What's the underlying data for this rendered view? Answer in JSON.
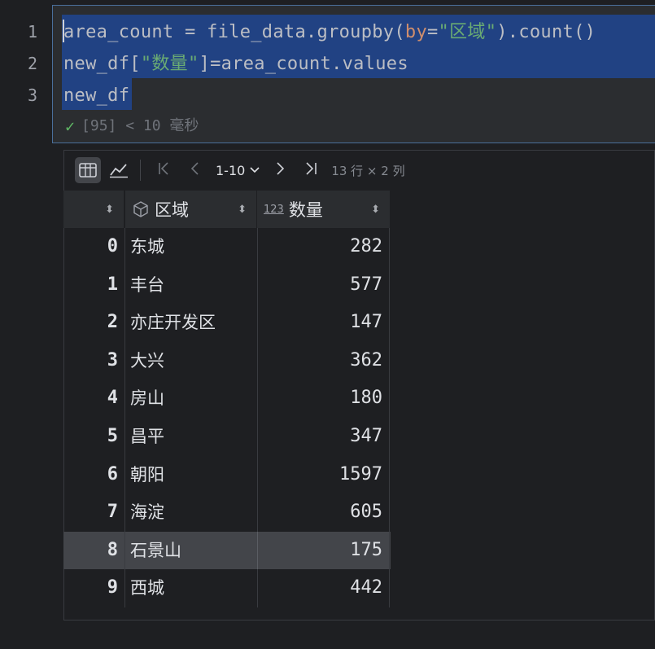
{
  "editor": {
    "line_numbers": [
      "1",
      "2",
      "3"
    ],
    "lines": [
      [
        {
          "t": "area_count = file_data.groupby(",
          "k": "plain"
        },
        {
          "t": "by",
          "k": "param"
        },
        {
          "t": "=",
          "k": "plain"
        },
        {
          "t": "\"区域\"",
          "k": "str"
        },
        {
          "t": ").count()",
          "k": "plain"
        }
      ],
      [
        {
          "t": "new_df[",
          "k": "plain"
        },
        {
          "t": "\"数量\"",
          "k": "str"
        },
        {
          "t": "]=area_count.values",
          "k": "plain"
        }
      ],
      [
        {
          "t": "new_df",
          "k": "plain"
        }
      ]
    ],
    "exec_status": "[95] < 10 毫秒"
  },
  "toolbar": {
    "page_range": "1-10",
    "row_col_info": "13 行 × 2 列"
  },
  "table": {
    "columns": [
      "区域",
      "数量"
    ],
    "rows": [
      {
        "idx": "0",
        "area": "东城",
        "count": "282"
      },
      {
        "idx": "1",
        "area": "丰台",
        "count": "577"
      },
      {
        "idx": "2",
        "area": "亦庄开发区",
        "count": "147"
      },
      {
        "idx": "3",
        "area": "大兴",
        "count": "362"
      },
      {
        "idx": "4",
        "area": "房山",
        "count": "180"
      },
      {
        "idx": "5",
        "area": "昌平",
        "count": "347"
      },
      {
        "idx": "6",
        "area": "朝阳",
        "count": "1597"
      },
      {
        "idx": "7",
        "area": "海淀",
        "count": "605"
      },
      {
        "idx": "8",
        "area": "石景山",
        "count": "175"
      },
      {
        "idx": "9",
        "area": "西城",
        "count": "442"
      }
    ],
    "selected_row": 8
  },
  "colors": {
    "selection": "#214283",
    "string": "#6aab73",
    "param": "#cf8e6d",
    "success": "#5fb865"
  }
}
